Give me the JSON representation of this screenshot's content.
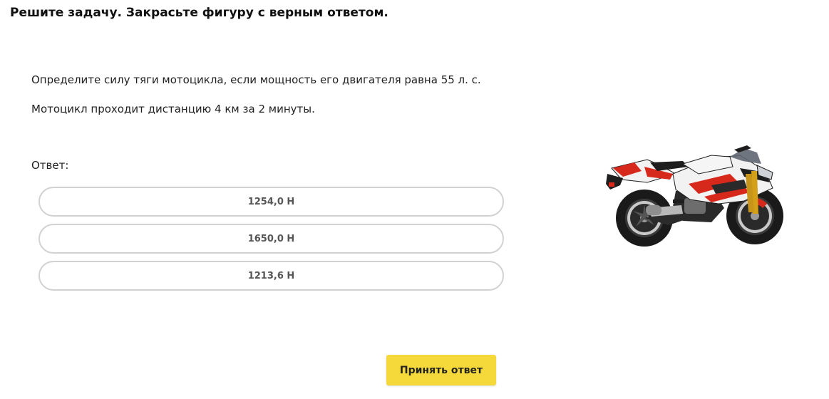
{
  "task": {
    "title": "Решите задачу. Закрасьте фигуру с верным ответом."
  },
  "problem": {
    "line1": "Определите силу тяги мотоцикла, если мощность его двигателя равна 55 л. с.",
    "line2": "Мотоцикл проходит дистанцию 4 км за 2 минуты."
  },
  "answer": {
    "label": "Ответ:",
    "options": [
      "1254,0 Н",
      "1650,0 Н",
      "1213,6 Н"
    ]
  },
  "submit": {
    "label": "Принять ответ"
  },
  "illustration": {
    "icon": "motorcycle-illustration",
    "colors": {
      "body_red": "#d7281c",
      "body_white": "#f2f2f2",
      "body_black": "#1e1e1e",
      "button_yellow": "#f5d93b"
    }
  }
}
